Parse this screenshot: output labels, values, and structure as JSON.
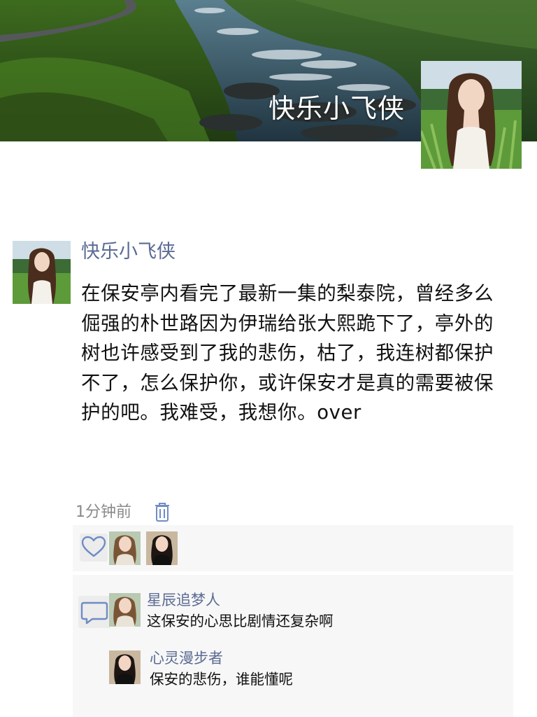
{
  "cover": {
    "username": "快乐小飞侠",
    "image": "mountain-stream-landscape"
  },
  "profile_avatar": "woman-in-field-avatar",
  "post": {
    "username": "快乐小飞侠",
    "text": "在保安亭内看完了最新一集的梨泰院，曾经多么倔强的朴世路因为伊瑞给张大熙跪下了，亭外的树也许感受到了我的悲伤，枯了，我连树都保护不了，怎么保护你，或许保安才是真的需要被保护的吧。我难受，我想你。over",
    "time": "1分钟前",
    "delete_icon": "trash-icon"
  },
  "likes": {
    "icon": "heart-icon",
    "avatars": [
      "woman-blonde-avatar",
      "woman-dark-hair-avatar"
    ]
  },
  "comments": {
    "icon": "comment-bubble-icon",
    "items": [
      {
        "username": "星辰追梦人",
        "text": "这保安的心思比剧情还复杂啊",
        "avatar": "woman-blonde-avatar"
      },
      {
        "username": "心灵漫步者",
        "text": "保安的悲伤，谁能懂呢",
        "avatar": "woman-dark-hair-avatar"
      }
    ]
  },
  "colors": {
    "username_blue": "#5b6b93",
    "panel_bg": "#f7f7f7",
    "time_gray": "#8a8a8a"
  }
}
